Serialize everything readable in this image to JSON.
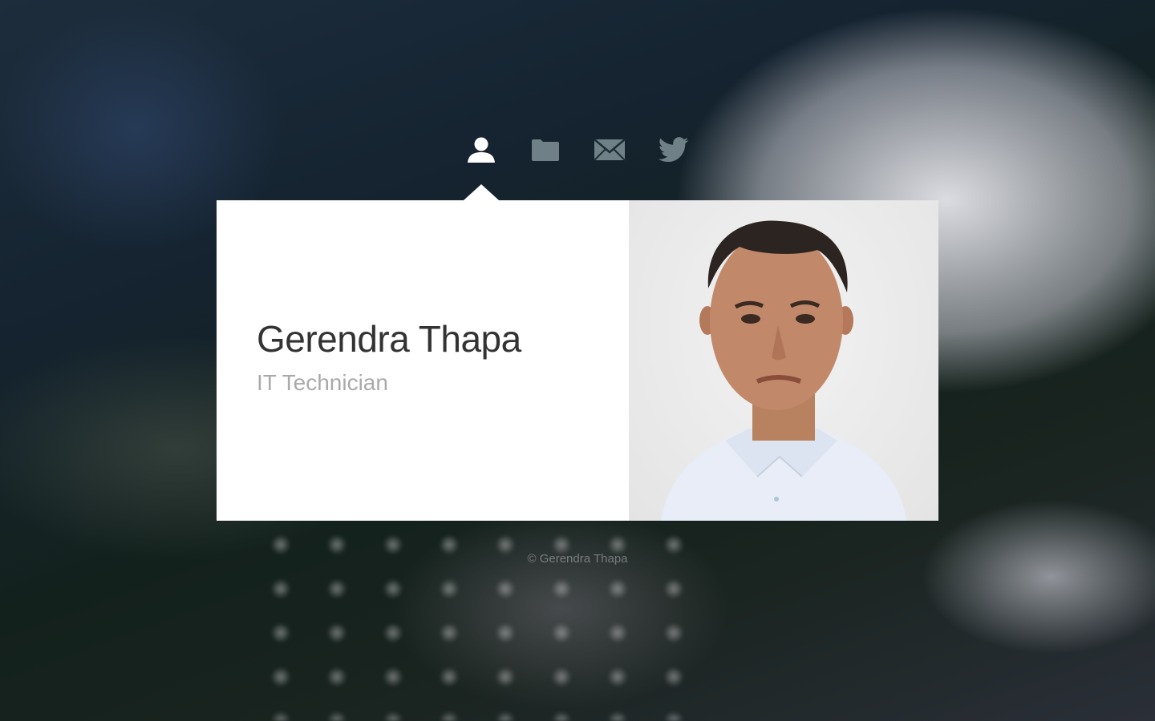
{
  "nav": {
    "items": [
      {
        "icon": "user-icon",
        "active": true
      },
      {
        "icon": "folder-icon",
        "active": false
      },
      {
        "icon": "mail-icon",
        "active": false
      },
      {
        "icon": "twitter-icon",
        "active": false
      }
    ]
  },
  "profile": {
    "name": "Gerendra Thapa",
    "title": "IT Technician"
  },
  "footer": {
    "copyright": "© Gerendra Thapa"
  },
  "colors": {
    "card": "#ffffff",
    "name_text": "#333333",
    "title_text": "#aaaaaa",
    "next_button": "#333333",
    "nav_active": "#ffffff",
    "nav_inactive": "#6f8087"
  }
}
